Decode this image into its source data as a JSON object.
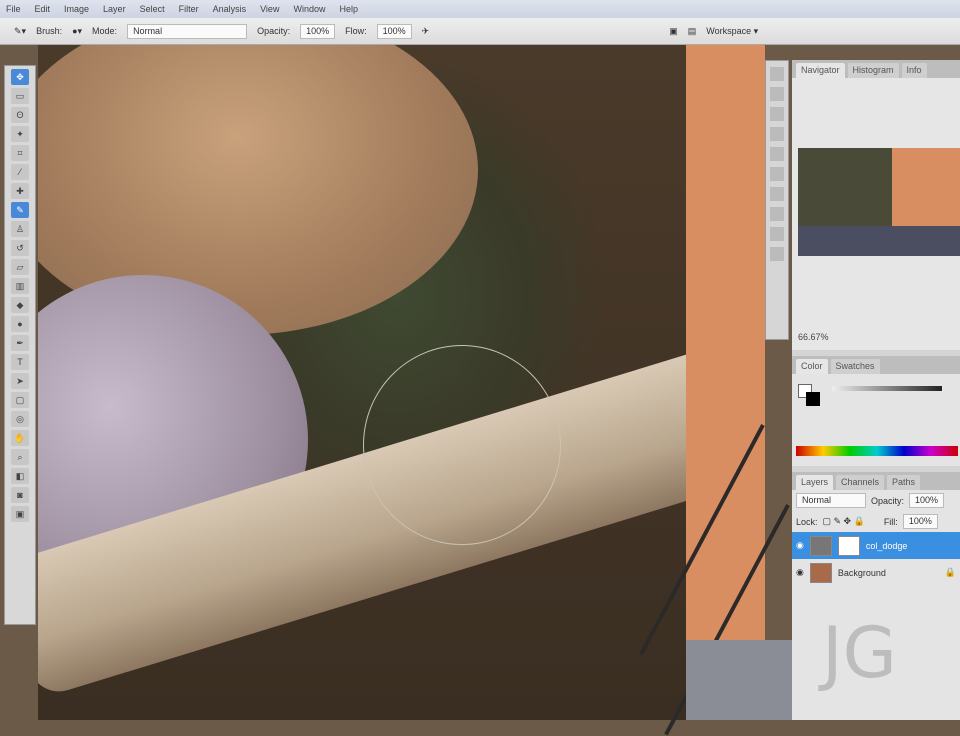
{
  "menu": [
    "File",
    "Edit",
    "Image",
    "Layer",
    "Select",
    "Filter",
    "Analysis",
    "View",
    "Window",
    "Help"
  ],
  "options": {
    "brush_label": "Brush:",
    "mode_label": "Mode:",
    "mode_value": "Normal",
    "opacity_label": "Opacity:",
    "opacity_value": "100%",
    "flow_label": "Flow:",
    "flow_value": "100%",
    "workspace": "Workspace ▾"
  },
  "navigator": {
    "tabs": [
      "Navigator",
      "Histogram",
      "Info"
    ],
    "zoom": "66.67%"
  },
  "color": {
    "tabs": [
      "Color",
      "Swatches"
    ]
  },
  "layers": {
    "tabs": [
      "Layers",
      "Channels",
      "Paths"
    ],
    "blend_mode": "Normal",
    "opacity_label": "Opacity:",
    "opacity_value": "100%",
    "lock_label": "Lock:",
    "fill_label": "Fill:",
    "fill_value": "100%",
    "items": [
      {
        "name": "col_dodge",
        "selected": true
      },
      {
        "name": "Background",
        "selected": false
      }
    ]
  },
  "watermark": "JG"
}
